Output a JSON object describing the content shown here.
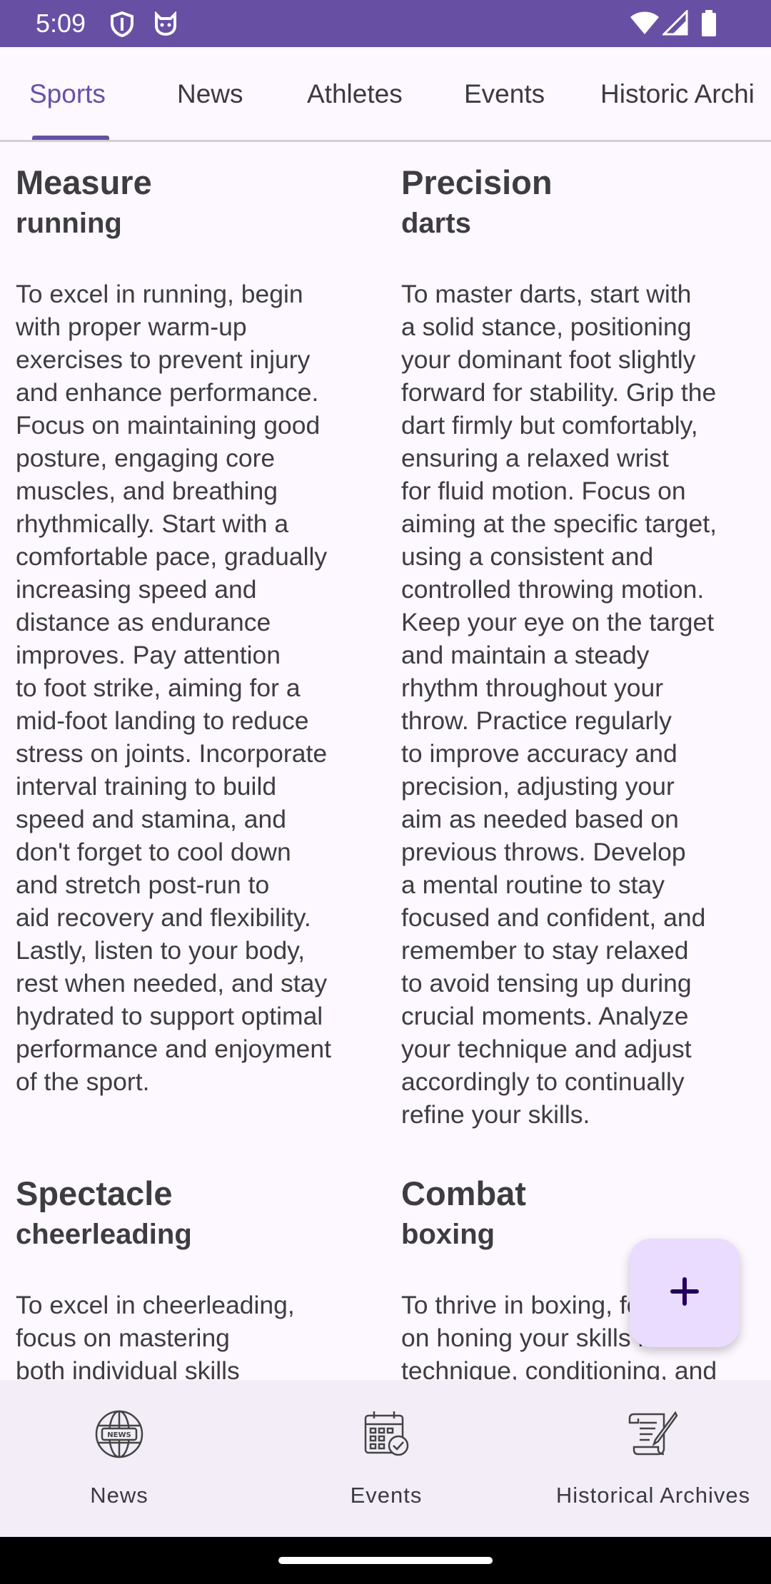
{
  "status_bar": {
    "time": "5:09",
    "left_icons": [
      "shield-icon",
      "cat-face-icon"
    ],
    "right_icons": [
      "wifi-icon",
      "signal-icon",
      "battery-icon"
    ],
    "color": "#6750a4"
  },
  "tabs": {
    "items": [
      {
        "label": "Sports",
        "active": true
      },
      {
        "label": "News",
        "active": false
      },
      {
        "label": "Athletes",
        "active": false
      },
      {
        "label": "Events",
        "active": false
      },
      {
        "label": "Historic Archi",
        "active": false
      }
    ],
    "accent": "#6750a4"
  },
  "cards": [
    {
      "category": "Measure",
      "sport": "running",
      "description_lines": [
        "To excel in running, begin",
        "with proper warm-up",
        "exercises to prevent injury",
        "and enhance performance.",
        "Focus on maintaining good",
        "posture, engaging core",
        "muscles, and breathing",
        "rhythmically. Start with a",
        "comfortable pace, gradually",
        "increasing speed and",
        "distance as endurance",
        "improves. Pay attention",
        "to foot strike, aiming for a",
        "mid-foot landing to reduce",
        "stress on joints. Incorporate",
        "interval training to build",
        "speed and stamina, and",
        "don't forget to cool down",
        "and stretch post-run to",
        "aid recovery and flexibility.",
        "Lastly, listen to your body,",
        "rest when needed, and stay",
        "hydrated to support optimal",
        "performance and enjoyment",
        "of the sport."
      ]
    },
    {
      "category": "Precision",
      "sport": "darts",
      "description_lines": [
        "To master darts, start with",
        "a solid stance, positioning",
        "your dominant foot slightly",
        "forward for stability. Grip the",
        "dart firmly but comfortably,",
        "ensuring a relaxed wrist",
        "for fluid motion. Focus on",
        "aiming at the specific target,",
        "using a consistent and",
        "controlled throwing motion.",
        "Keep your eye on the target",
        "and maintain a steady",
        "rhythm throughout your",
        "throw. Practice regularly",
        "to improve accuracy and",
        "precision, adjusting your",
        "aim as needed based on",
        "previous throws. Develop",
        "a mental routine to stay",
        "focused and confident, and",
        "remember to stay relaxed",
        "to avoid tensing up during",
        "crucial moments. Analyze",
        "your technique and adjust",
        "accordingly to continually",
        "refine your skills."
      ]
    },
    {
      "category": "Spectacle",
      "sport": "cheerleading",
      "description_lines": [
        "To excel in cheerleading,",
        "focus on mastering",
        "both individual skills"
      ]
    },
    {
      "category": "Combat",
      "sport": "boxing",
      "description_lines": [
        "To thrive in boxing, focus",
        "on honing your skills in",
        "technique, conditioning, and"
      ]
    }
  ],
  "fab": {
    "icon": "plus-icon",
    "color": "#eadcff"
  },
  "bottom_nav": {
    "items": [
      {
        "label": "News",
        "icon": "news-globe-icon"
      },
      {
        "label": "Events",
        "icon": "calendar-icon"
      },
      {
        "label": "Historical Archives",
        "icon": "scroll-quill-icon"
      }
    ]
  }
}
